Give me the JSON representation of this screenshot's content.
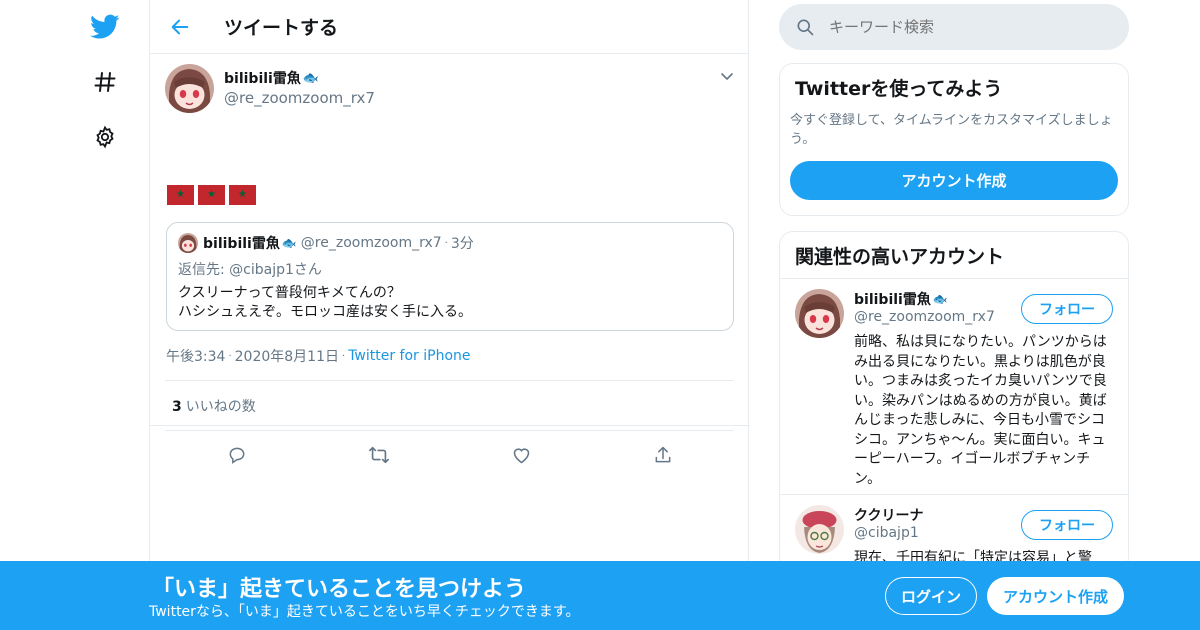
{
  "nav": {
    "icons": [
      "twitter-bird-icon",
      "hashtag-icon",
      "settings-gear-icon"
    ]
  },
  "header": {
    "title": "ツイートする",
    "back_icon": "arrow-left-icon"
  },
  "tweet": {
    "author_name": "bilibili雷魚",
    "author_emoji": "🐟",
    "author_handle": "@re_zoomzoom_rx7",
    "flags": [
      "★",
      "★",
      "★"
    ],
    "quote": {
      "author_name": "bilibili雷魚",
      "author_emoji": "🐟",
      "author_handle": "@re_zoomzoom_rx7",
      "time": "3分",
      "reply_to": "返信先: @cibajp1さん",
      "text_line1": "クスリーナって普段何キメてんの？",
      "text_line2": "ハシシュええぞ。モロッコ産は安く手に入る。"
    },
    "time": "午後3:34",
    "date": "2020年8月11日",
    "source": "Twitter for iPhone",
    "likes_count": "3",
    "likes_label": "いいねの数"
  },
  "search": {
    "placeholder": "キーワード検索"
  },
  "signup_card": {
    "title": "Twitterを使ってみよう",
    "desc": "今すぐ登録して、タイムラインをカスタマイズしましょう。",
    "button": "アカウント作成"
  },
  "related": {
    "title": "関連性の高いアカウント",
    "accounts": [
      {
        "name": "bilibili雷魚",
        "emoji": "🐟",
        "handle": "@re_zoomzoom_rx7",
        "follow": "フォロー",
        "bio": "前略、私は貝になりたい。パンツからはみ出る貝になりたい。黒よりは肌色が良い。つまみは炙ったイカ臭いパンツで良い。染みパンはぬるめの方が良い。黄ばんじまった悲しみに、今日も小雪でシコシコ。アンちゃ〜ん。実に面白い。キューピーハーフ。イゴールボブチャンチン。"
      },
      {
        "name": "ククリーナ",
        "handle": "@cibajp1",
        "follow": "フォロー",
        "bio": "現在、千田有紀に「特定は容易」と警"
      }
    ]
  },
  "bottom_bar": {
    "title": "「いま」起きていることを見つけよう",
    "subtitle": "Twitterなら、「いま」起きていることをいち早くチェックできます。",
    "login": "ログイン",
    "signup": "アカウント作成"
  },
  "colors": {
    "accent": "#1da1f2",
    "link": "#1b95e0",
    "muted": "#657786",
    "border": "#e6ecf0"
  }
}
